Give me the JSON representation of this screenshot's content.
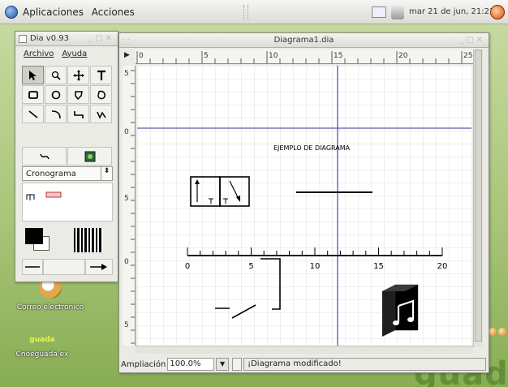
{
  "panel": {
    "menu": [
      "Aplicaciones",
      "Acciones"
    ],
    "clock": "mar 21 de jun, 21:23"
  },
  "desktop": {
    "mail_icon_label": "Correo electrónico",
    "guada_icon_logo": "guada",
    "guada_icon_label": "Cnoeguada.ex"
  },
  "toolbox": {
    "title": "Dia v0.93",
    "menu": [
      "Archivo",
      "Ayuda"
    ],
    "sheet": "Cronograma",
    "tools": [
      "pointer-tool",
      "zoom-tool",
      "move-tool",
      "text-tool",
      "box-tool",
      "ellipse-tool",
      "polygon-tool",
      "beziergon-tool",
      "line-tool",
      "arc-tool",
      "zigzag-tool",
      "polyline-tool"
    ],
    "extra_tools": [
      "bezierline-tool",
      "image-tool"
    ]
  },
  "diagram": {
    "title": "Diagrama1.dia",
    "ruler_h_labels": [
      "0",
      "5",
      "10",
      "15",
      "20",
      "25"
    ],
    "ruler_v_labels": [
      "5",
      "0",
      "5",
      "0",
      "5"
    ],
    "canvas_text": "EJEMPLO DE DIAGRAMA",
    "scale_labels": [
      "0",
      "5",
      "10",
      "15",
      "20"
    ],
    "zoom_label": "Ampliación",
    "zoom_value": "100.0%",
    "status_text": "¡Diagrama modificado!"
  }
}
